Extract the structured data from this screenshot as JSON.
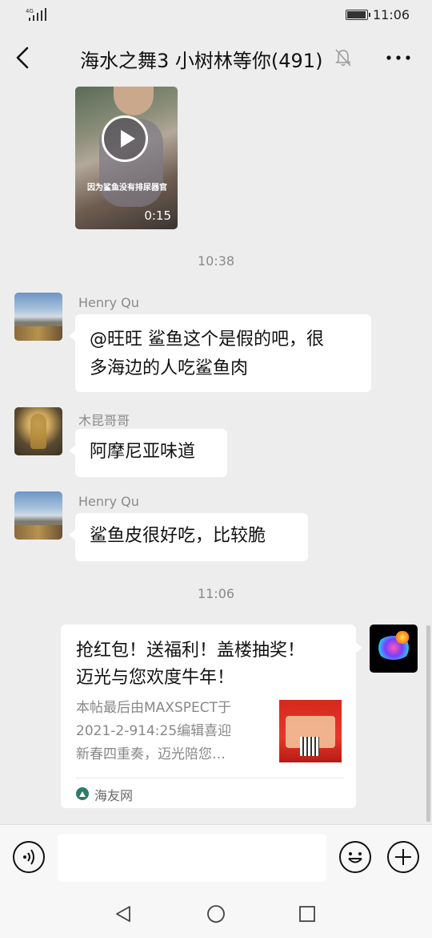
{
  "status_bar": {
    "network": "4G",
    "time": "11:06"
  },
  "header": {
    "title": "海水之舞3 小树林等你(491)"
  },
  "messages": {
    "video": {
      "caption": "因为鲨鱼没有排尿器官",
      "duration": "0:15"
    },
    "time_1": "10:38",
    "msg_1": {
      "sender": "Henry Qu",
      "text_line1": "@旺旺  鲨鱼这个是假的吧，很",
      "text_line2": "多海边的人吃鲨鱼肉"
    },
    "msg_2": {
      "sender": "木昆哥哥",
      "text": "阿摩尼亚味道"
    },
    "msg_3": {
      "sender": "Henry Qu",
      "text": "鲨鱼皮很好吃，比较脆"
    },
    "time_2": "11:06",
    "link_card": {
      "title_line1": "抢红包！送福利！盖楼抽奖！",
      "title_line2": "迈光与您欢度牛年！",
      "desc_line1": "本帖最后由MAXSPECT于",
      "desc_line2": "2021-2-914:25编辑喜迎",
      "desc_line3": "新春四重奏，迈光陪您…",
      "source": "海友网"
    }
  },
  "input_bar": {
    "placeholder": ""
  },
  "icons": {
    "back": "chevron-left-icon",
    "mute": "bell-off-icon",
    "more": "ellipsis-icon",
    "voice": "voice-icon",
    "emoji": "emoji-icon",
    "plus": "plus-icon",
    "nav_back": "triangle-back-icon",
    "nav_home": "circle-home-icon",
    "nav_recent": "square-recent-icon"
  },
  "colors": {
    "background": "#ededed",
    "bubble": "#ffffff",
    "muted_text": "#8a8a8a"
  }
}
